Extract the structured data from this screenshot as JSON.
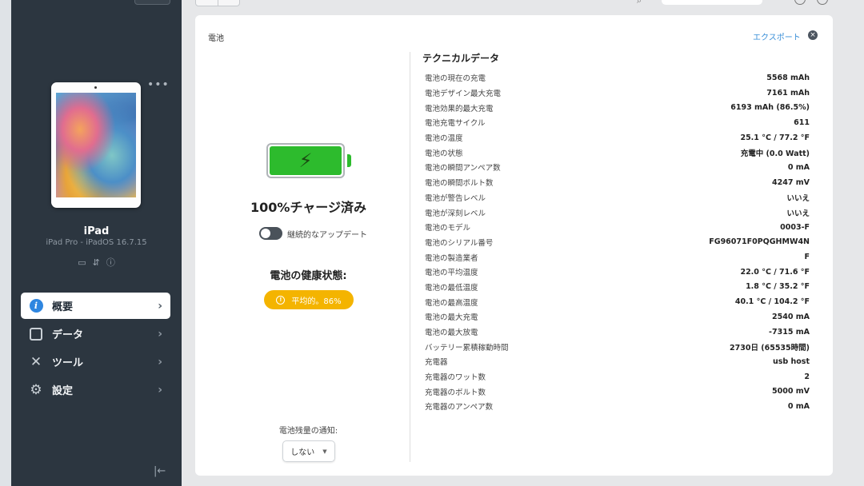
{
  "sidebar": {
    "device": {
      "name": "iPad",
      "subtitle": "iPad Pro - iPadOS 16.7.15"
    },
    "nav": [
      {
        "label": "概要",
        "icon": "info-icon",
        "active": true
      },
      {
        "label": "データ",
        "icon": "square-icon",
        "active": false
      },
      {
        "label": "ツール",
        "icon": "tools-icon",
        "active": false
      },
      {
        "label": "設定",
        "icon": "gear-icon",
        "active": false
      }
    ]
  },
  "card": {
    "title": "電池",
    "export_label": "エクスポート",
    "charge_text": "100%チャージ済み",
    "toggle_label": "継続的なアップデート",
    "health_title": "電池の健康状態:",
    "health_badge": "平均的。86%",
    "notify_label": "電池残量の通知:",
    "notify_value": "しない",
    "battery_level": 1.0,
    "tech_title": "テクニカルデータ",
    "tech": [
      {
        "key": "電池の現在の充電",
        "value": "5568 mAh"
      },
      {
        "key": "電池デザイン最大充電",
        "value": "7161 mAh"
      },
      {
        "key": "電池効果的最大充電",
        "value": "6193 mAh (86.5%)"
      },
      {
        "key": "電池充電サイクル",
        "value": "611"
      },
      {
        "key": "電池の温度",
        "value": "25.1 °C / 77.2 °F"
      },
      {
        "key": "電池の状態",
        "value": "充電中 (0.0 Watt)"
      },
      {
        "key": "電池の瞬間アンペア数",
        "value": "0 mA"
      },
      {
        "key": "電池の瞬間ボルト数",
        "value": "4247 mV"
      },
      {
        "key": "電池が警告レベル",
        "value": "いいえ"
      },
      {
        "key": "電池が深刻レベル",
        "value": "いいえ"
      },
      {
        "key": "電池のモデル",
        "value": "0003-F"
      },
      {
        "key": "電池のシリアル番号",
        "value": "FG96071F0PQGHMW4N"
      },
      {
        "key": "電池の製造業者",
        "value": "F"
      },
      {
        "key": "電池の平均温度",
        "value": "22.0 °C / 71.6 °F"
      },
      {
        "key": "電池の最低温度",
        "value": "1.8 °C / 35.2 °F"
      },
      {
        "key": "電池の最高温度",
        "value": "40.1 °C / 104.2 °F"
      },
      {
        "key": "電池の最大充電",
        "value": "2540 mA"
      },
      {
        "key": "電池の最大放電",
        "value": "-7315 mA"
      },
      {
        "key": "バッテリー累積稼動時間",
        "value": "2730日 (65535時間)"
      },
      {
        "key": "充電器",
        "value": "usb host"
      },
      {
        "key": "充電器のワット数",
        "value": "2"
      },
      {
        "key": "充電器のボルト数",
        "value": "5000 mV"
      },
      {
        "key": "充電器のアンペア数",
        "value": "0 mA"
      }
    ]
  },
  "colors": {
    "sidebar_bg": "#2c3640",
    "accent_blue": "#2f86e0",
    "battery_green": "#2dbb2d",
    "health_amber": "#f4b400"
  }
}
